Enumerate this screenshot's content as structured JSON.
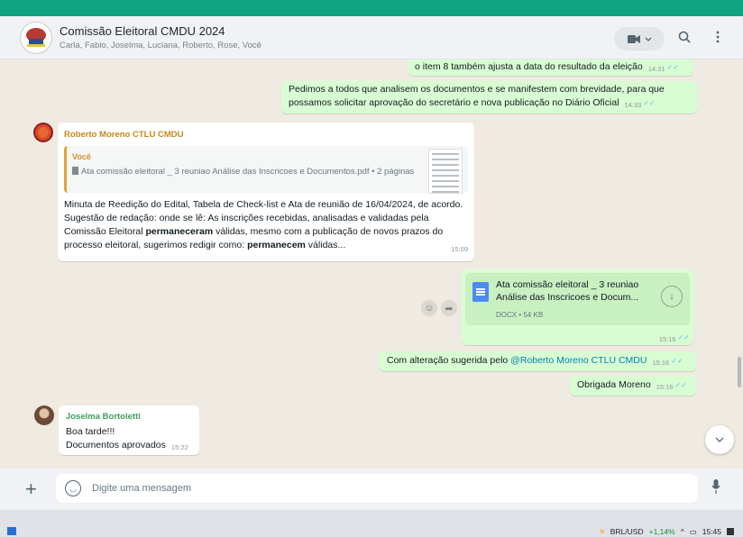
{
  "header": {
    "title": "Comissão Eleitoral CMDU 2024",
    "subtitle": "Carla, Fabio, Joselma, Luciana, Roberto, Rose, Você",
    "video_icon": "video-camera-icon",
    "dropdown_icon": "chevron-down-icon",
    "search_icon": "search-icon",
    "menu_icon": "kebab-menu-icon"
  },
  "messages": [
    {
      "type": "outgoing",
      "text": "o item 8 também ajusta a data do resultado da eleição",
      "time": "14:31"
    },
    {
      "type": "outgoing",
      "text": "Pedimos a todos que analisem os documentos e se manifestem com brevidade, para que possamos solicitar aprovação do secretário e nova publicação no Diário Oficial",
      "time": "14:33"
    },
    {
      "type": "incoming",
      "sender": "Roberto Moreno CTLU CMDU",
      "quote": {
        "author": "Você",
        "text": "Ata comissão eleitoral _ 3 reuniao Análise das Inscricoes e Documentos.pdf • 2 páginas"
      },
      "text_parts": [
        "Minuta de Reedição do Edital, Tabela de Check-list e Ata de reunião de 16/04/2024, de acordo. Sugestão de redação: onde se lê: As inscrições recebidas, analisadas e validadas pela Comissão Eleitoral ",
        "permaneceram",
        " válidas, mesmo com a publicação de novos prazos do processo eleitoral, sugerimos redigir como: ",
        "permanecem",
        " válidas..."
      ],
      "time": "15:09"
    },
    {
      "type": "outgoing-document",
      "title": "Ata comissão eleitoral _ 3 reuniao Análise das Inscricoes e Docum...",
      "meta": "DOCX • 54 KB",
      "time": "15:16"
    },
    {
      "type": "outgoing",
      "text_prefix": "Com alteração sugerida pelo ",
      "mention": "@Roberto Moreno CTLU CMDU",
      "time": "15:16"
    },
    {
      "type": "outgoing",
      "text": "Obrigada Moreno",
      "time": "15:16"
    },
    {
      "type": "incoming",
      "sender": "Joselma Bortoletti",
      "line1": "Boa tarde!!!",
      "line2": "Documentos aprovados",
      "time": "15:22"
    }
  ],
  "composer": {
    "placeholder": "Digite uma mensagem",
    "value": ""
  },
  "taskbar": {
    "ticker": "BRL/USD",
    "change": "+1,14%",
    "clock": "15:45"
  },
  "colors": {
    "accent": "#0fa47f",
    "outgoing_bubble": "#d9fdd3",
    "roberto_name": "#c2891d",
    "joselma_name": "#3e9f59",
    "mention": "#027eb5"
  }
}
